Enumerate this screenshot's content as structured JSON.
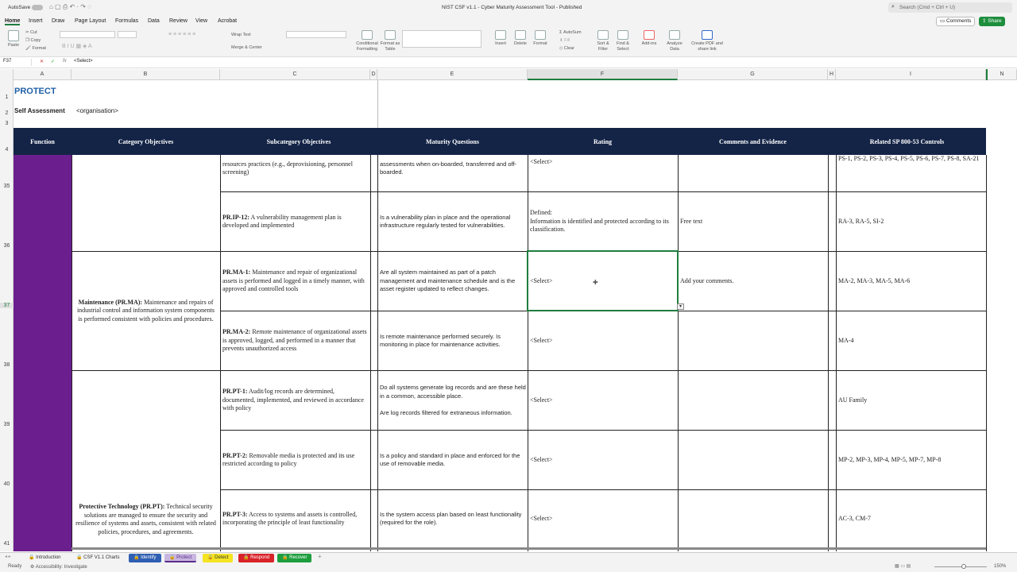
{
  "titlebar": {
    "autosave_label": "AutoSave",
    "doc_title": "NIST CSF v1.1 - Cyber  Maturity Assessment Tool - Published",
    "search_placeholder": "Search (Cmd + Ctrl + U)",
    "comments_label": "Comments",
    "share_label": "Share"
  },
  "ribbon_tabs": [
    "Home",
    "Insert",
    "Draw",
    "Page Layout",
    "Formulas",
    "Data",
    "Review",
    "View",
    "Acrobat"
  ],
  "ribbon": {
    "paste": "Paste",
    "cut": "Cut",
    "copy": "Copy",
    "format": "Format",
    "wrap_text": "Wrap Text",
    "merge_center": "Merge & Center",
    "conditional_formatting": "Conditional Formatting",
    "format_as_table": "Format as Table",
    "insert": "Insert",
    "delete": "Delete",
    "format_cells": "Format",
    "autosum": "AutoSum",
    "fill": "Fill",
    "clear": "Clear",
    "sort_filter": "Sort & Filter",
    "find_select": "Find & Select",
    "add_ins": "Add-ins",
    "analyze_data": "Analyze Data",
    "create_pdf": "Create PDF and share link"
  },
  "formula_bar": {
    "cell_ref": "F37",
    "fx": "fx",
    "value": "<Select>"
  },
  "columns": [
    "A",
    "B",
    "C",
    "D",
    "E",
    "F",
    "G",
    "H",
    "I",
    "N"
  ],
  "rows": [
    "1",
    "2",
    "3",
    "4",
    "35",
    "36",
    "37",
    "38",
    "39",
    "40",
    "41"
  ],
  "sheet": {
    "title": "PROTECT",
    "self_assessment_label": "Self Assessment",
    "organisation": "<organisation>",
    "headers": {
      "function": "Function",
      "category": "Category Objectives",
      "subcategory": "Subcategory Objectives",
      "maturity": "Maturity Questions",
      "rating": "Rating",
      "comments": "Comments and Evidence",
      "controls": "Related SP 800-53 Controls"
    },
    "categories": {
      "ma_code": "Maintenance (PR.MA):",
      "ma_text": " Maintenance and repairs of industrial control and information system components is performed consistent with policies and procedures.",
      "pt_code": "Protective Technology (PR.PT):",
      "pt_text": " Technical security solutions are managed to ensure the security and resilience of systems and assets, consistent with related policies, procedures, and agreements."
    },
    "rows": [
      {
        "sub_code": "",
        "sub_text": "resources practices (e.g., deprovisioning, personnel screening)",
        "question": "assessments when on-boarded, transferred and off-boarded.",
        "rating": "<Select>",
        "comment": "",
        "controls": "PS-1, PS-2, PS-3, PS-4, PS-5, PS-6, PS-7, PS-8, SA-21"
      },
      {
        "sub_code": "PR.IP-12:",
        "sub_text": " A vulnerability management plan is developed and implemented",
        "question": "Is a vulnerability plan in place and the operational infrastructure regularly tested for vulnerabilities.",
        "rating": "Defined:\nInformation is identified and protected according to its classification.",
        "comment": "Free text",
        "controls": "RA-3, RA-5, SI-2"
      },
      {
        "sub_code": "PR.MA-1:",
        "sub_text": " Maintenance and repair of organizational assets is performed and logged in a timely manner, with approved and controlled tools",
        "question": "Are all system maintained as part of a patch management and maintenance schedule and is the asset register updated to reflect changes.",
        "rating": "<Select>",
        "comment": "Add your comments.",
        "controls": "MA-2, MA-3, MA-5, MA-6"
      },
      {
        "sub_code": "PR.MA-2:",
        "sub_text": " Remote maintenance of organizational assets is approved, logged, and performed in a manner that prevents unauthorized access",
        "question": "Is remote maintenance performed securely.  Is monitoring in place for maintenance activities.",
        "rating": "<Select>",
        "comment": "",
        "controls": "MA-4"
      },
      {
        "sub_code": "PR.PT-1:",
        "sub_text": " Audit/log records are determined, documented, implemented, and reviewed in accordance with policy",
        "question": "Do all systems generate log records and are these held in a common, accessible place.\n\nAre log records filtered for extraneous information.",
        "rating": "<Select>",
        "comment": "",
        "controls": "AU Family"
      },
      {
        "sub_code": "PR.PT-2:",
        "sub_text": " Removable media is protected and its use restricted according to policy",
        "question": "Is a policy and standard in place and enforced for the use of removable media.",
        "rating": "<Select>",
        "comment": "",
        "controls": "MP-2, MP-3, MP-4, MP-5, MP-7, MP-8"
      },
      {
        "sub_code": "PR.PT-3:",
        "sub_text": " Access to systems and assets is controlled, incorporating the principle of least functionality",
        "question": "Is the system access plan based on least functionality (required for the role).",
        "rating": "<Select>",
        "comment": "",
        "controls": "AC-3, CM-7"
      }
    ]
  },
  "sheet_tabs": [
    {
      "label": "Introduction",
      "color": "#f3f3f3",
      "text": "#333"
    },
    {
      "label": "CSF V1.1 Charts",
      "color": "#f3f3f3",
      "text": "#333"
    },
    {
      "label": "Identify",
      "color": "#2f5fb3",
      "text": "#fff"
    },
    {
      "label": "Protect",
      "color": "#c9b6e0",
      "text": "#5a2d8a"
    },
    {
      "label": "Detect",
      "color": "#f4e422",
      "text": "#333"
    },
    {
      "label": "Respond",
      "color": "#d8232a",
      "text": "#fff"
    },
    {
      "label": "Recover",
      "color": "#1e9e3e",
      "text": "#fff"
    }
  ],
  "statusbar": {
    "ready": "Ready",
    "accessibility": "Accessibility: Investigate",
    "zoom": "150%"
  },
  "colors": {
    "header_navy": "#142447",
    "function_purple": "#6b1f8e",
    "title_blue": "#1f5fa5",
    "share_green": "#1e8e3e"
  }
}
